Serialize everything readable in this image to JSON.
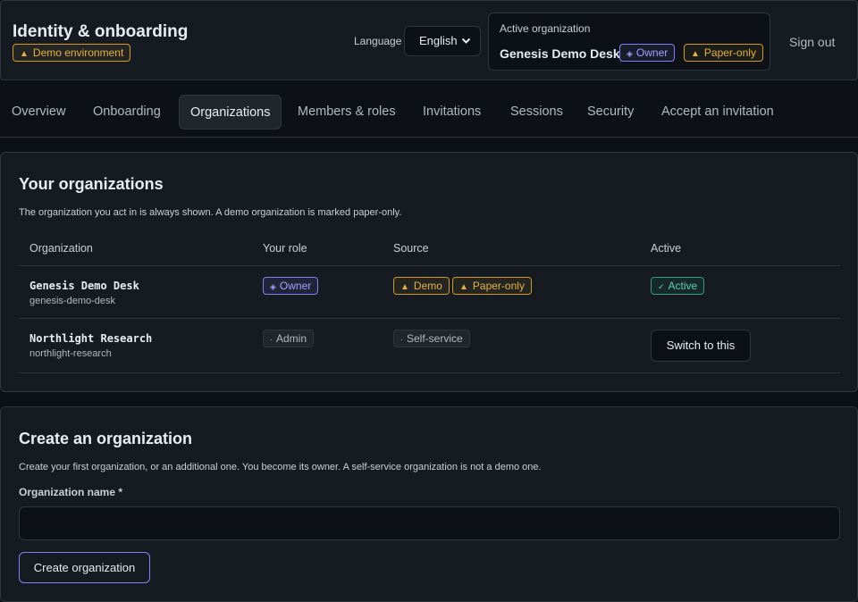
{
  "header": {
    "title": "Identity & onboarding",
    "env_badge": "Demo environment",
    "language_label": "Language",
    "language_value": "English",
    "active_org_label": "Active organization",
    "active_org_name": "Genesis Demo Desk",
    "active_org_role": "Owner",
    "active_org_flag": "Paper-only",
    "sign_out": "Sign out"
  },
  "tabs": [
    {
      "label": "Overview"
    },
    {
      "label": "Onboarding"
    },
    {
      "label": "Organizations",
      "active": true
    },
    {
      "label": "Members & roles"
    },
    {
      "label": "Invitations"
    },
    {
      "label": "Sessions"
    },
    {
      "label": "Security"
    },
    {
      "label": "Accept an invitation"
    }
  ],
  "orgs_section": {
    "title": "Your organizations",
    "description": "The organization you act in is always shown. A demo organization is marked paper-only.",
    "columns": [
      "Organization",
      "Your role",
      "Source",
      "Active"
    ],
    "rows": [
      {
        "name": "Genesis Demo Desk",
        "slug": "genesis-demo-desk",
        "role": "Owner",
        "sources": [
          "Demo",
          "Paper-only"
        ],
        "active": "Active"
      },
      {
        "name": "Northlight Research",
        "slug": "northlight-research",
        "role": "Admin",
        "sources": [
          "Self-service"
        ],
        "action": "Switch to this"
      }
    ]
  },
  "create_section": {
    "title": "Create an organization",
    "description": "Create your first organization, or an additional one. You become its owner. A self-service organization is not a demo one.",
    "field_label": "Organization name *",
    "field_value": "",
    "submit": "Create organization"
  },
  "colors": {
    "accent": "#8b7cf6",
    "warning": "#d29922",
    "success": "#2ea07a",
    "background": "#0d1117",
    "surface": "#161b22"
  }
}
